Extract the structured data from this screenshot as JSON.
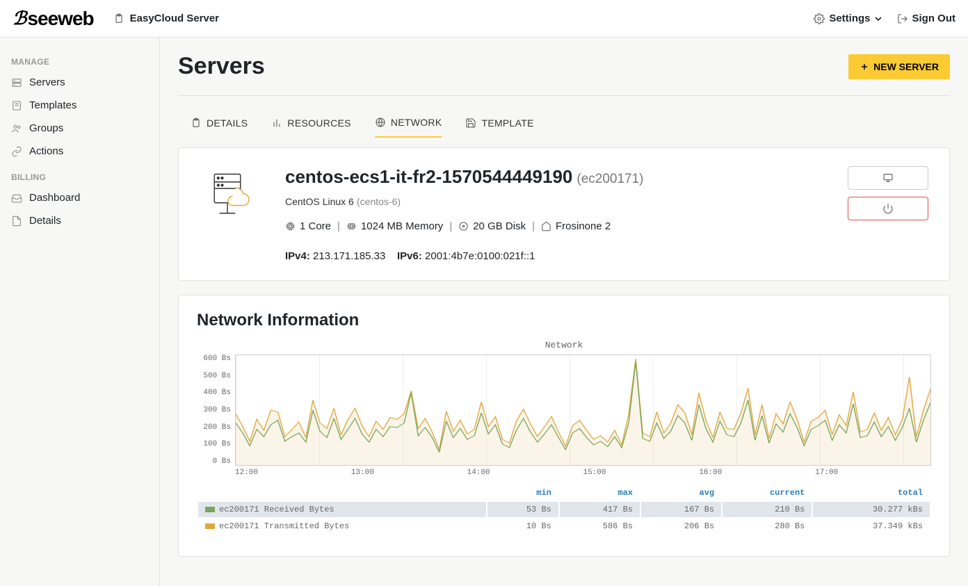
{
  "header": {
    "brand": "seeweb",
    "product": "EasyCloud Server",
    "settings": "Settings",
    "signout": "Sign Out"
  },
  "sidebar": {
    "sec_manage": "MANAGE",
    "sec_billing": "BILLING",
    "items_manage": [
      "Servers",
      "Templates",
      "Groups",
      "Actions"
    ],
    "items_billing": [
      "Dashboard",
      "Details"
    ]
  },
  "page": {
    "title": "Servers",
    "new_server": "NEW SERVER"
  },
  "tabs": {
    "details": "DETAILS",
    "resources": "RESOURCES",
    "network": "NETWORK",
    "template": "TEMPLATE"
  },
  "server": {
    "name": "centos-ecs1-it-fr2-1570544449190",
    "id": "(ec200171)",
    "os": "CentOS Linux 6",
    "os_tag": "(centos-6)",
    "cores": "1 Core",
    "memory": "1024 MB Memory",
    "disk": "20 GB Disk",
    "location": "Frosinone 2",
    "ipv4_label": "IPv4:",
    "ipv4": "213.171.185.33",
    "ipv6_label": "IPv6:",
    "ipv6": "2001:4b7e:0100:021f::1"
  },
  "network": {
    "title": "Network Information",
    "legend_headers": [
      "",
      "min",
      "max",
      "avg",
      "current",
      "total"
    ],
    "rows": [
      {
        "swatch": "#7aa65b",
        "label": "ec200171 Received Bytes",
        "min": "53 Bs",
        "max": "417 Bs",
        "avg": "167 Bs",
        "current": "210 Bs",
        "total": "30.277 kBs"
      },
      {
        "swatch": "#e1a73e",
        "label": "ec200171 Transmitted Bytes",
        "min": "10 Bs",
        "max": "586 Bs",
        "avg": "206 Bs",
        "current": "280 Bs",
        "total": "37.349 kBs"
      }
    ]
  },
  "chart_data": {
    "type": "line",
    "title": "Network",
    "xlabel": "",
    "ylabel": "",
    "ylim": [
      0,
      600
    ],
    "y_ticks": [
      "600 Bs",
      "500 Bs",
      "400 Bs",
      "300 Bs",
      "200 Bs",
      "100 Bs",
      "0 Bs"
    ],
    "x_ticks": [
      "12:00",
      "13:00",
      "14:00",
      "15:00",
      "16:00",
      "17:00"
    ],
    "x": [
      0,
      1,
      2,
      3,
      4,
      5,
      6,
      7,
      8,
      9,
      10,
      11,
      12,
      13,
      14,
      15,
      16,
      17,
      18,
      19,
      20,
      21,
      22,
      23,
      24,
      25,
      26,
      27,
      28,
      29,
      30,
      31,
      32,
      33,
      34,
      35,
      36,
      37,
      38,
      39,
      40,
      41,
      42,
      43,
      44,
      45,
      46,
      47,
      48,
      49,
      50,
      51,
      52,
      53,
      54,
      55,
      56,
      57,
      58,
      59,
      60,
      61,
      62,
      63,
      64,
      65,
      66,
      67,
      68,
      69,
      70,
      71,
      72,
      73,
      74,
      75,
      76,
      77,
      78,
      79,
      80,
      81,
      82,
      83,
      84,
      85,
      86,
      87,
      88,
      89,
      90,
      91,
      92,
      93,
      94,
      95,
      96,
      97,
      98,
      99
    ],
    "series": [
      {
        "name": "ec200171 Received Bytes",
        "color": "#7aa65b",
        "values": [
          230,
          175,
          105,
          195,
          155,
          220,
          245,
          130,
          155,
          175,
          125,
          300,
          185,
          150,
          255,
          140,
          195,
          255,
          170,
          125,
          195,
          155,
          210,
          205,
          230,
          395,
          160,
          205,
          150,
          70,
          240,
          150,
          200,
          140,
          160,
          285,
          170,
          220,
          115,
          95,
          190,
          255,
          180,
          125,
          170,
          220,
          150,
          85,
          175,
          200,
          150,
          110,
          130,
          100,
          155,
          95,
          230,
          565,
          145,
          130,
          230,
          145,
          185,
          270,
          230,
          135,
          330,
          200,
          125,
          240,
          165,
          155,
          230,
          355,
          135,
          270,
          120,
          225,
          180,
          280,
          205,
          105,
          195,
          215,
          245,
          135,
          220,
          175,
          335,
          150,
          160,
          235,
          155,
          210,
          135,
          205,
          310,
          125,
          245,
          340
        ]
      },
      {
        "name": "ec200171 Transmitted Bytes",
        "color": "#e1a73e",
        "values": [
          280,
          210,
          130,
          250,
          190,
          300,
          290,
          155,
          195,
          235,
          150,
          355,
          230,
          200,
          310,
          165,
          250,
          310,
          215,
          155,
          240,
          195,
          260,
          250,
          280,
          405,
          200,
          255,
          180,
          85,
          295,
          185,
          245,
          170,
          195,
          345,
          210,
          265,
          140,
          120,
          240,
          305,
          225,
          155,
          210,
          265,
          180,
          105,
          215,
          245,
          190,
          140,
          160,
          125,
          190,
          110,
          280,
          580,
          175,
          155,
          290,
          175,
          230,
          330,
          285,
          165,
          395,
          245,
          150,
          290,
          200,
          195,
          285,
          420,
          165,
          330,
          145,
          280,
          225,
          345,
          250,
          125,
          240,
          260,
          300,
          165,
          275,
          215,
          400,
          180,
          195,
          285,
          190,
          260,
          165,
          250,
          480,
          155,
          300,
          415
        ]
      }
    ]
  }
}
